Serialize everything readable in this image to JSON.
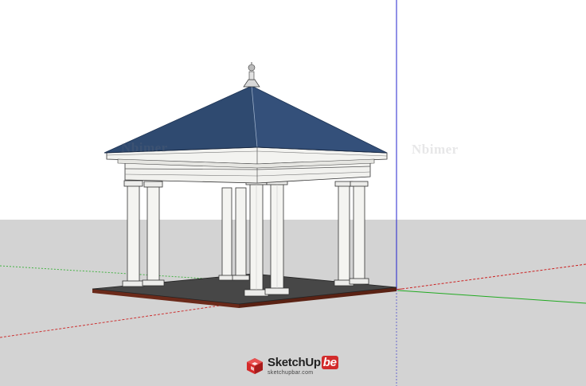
{
  "viewport": {
    "sky_color": "#ffffff",
    "ground_color": "#d3d3d3"
  },
  "axes": {
    "red_color": "#cc2222",
    "green_color": "#22aa22",
    "blue_color": "#2222cc"
  },
  "model": {
    "roof_color": "#2f4a70",
    "roof_edge_color": "#1f3555",
    "trim_color": "#f1f1ee",
    "column_color": "#f4f4f1",
    "platform_top_color": "#474747",
    "platform_edge_color": "#6b2a1a"
  },
  "watermarks": {
    "left": "Nbimer",
    "right": "Nbimer"
  },
  "logo": {
    "main_text": "SketchUp",
    "badge_text": "be",
    "site_text": "sketchupbar.com"
  }
}
